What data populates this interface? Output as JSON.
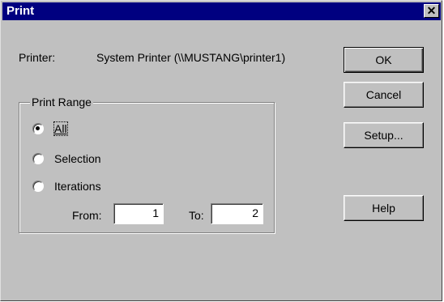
{
  "dialog": {
    "title": "Print",
    "close_glyph": "✕"
  },
  "printer": {
    "label": "Printer:",
    "value": "System Printer (\\\\MUSTANG\\printer1)"
  },
  "print_range": {
    "legend": "Print Range",
    "options": [
      {
        "label": "All",
        "selected": true
      },
      {
        "label": "Selection",
        "selected": false
      },
      {
        "label": "Iterations",
        "selected": false
      }
    ],
    "from_label": "From:",
    "from_value": "1",
    "to_label": "To:",
    "to_value": "2"
  },
  "buttons": {
    "ok": "OK",
    "cancel": "Cancel",
    "setup": "Setup...",
    "help": "Help"
  },
  "colors": {
    "titlebar": "#000080",
    "face": "#c0c0c0"
  }
}
